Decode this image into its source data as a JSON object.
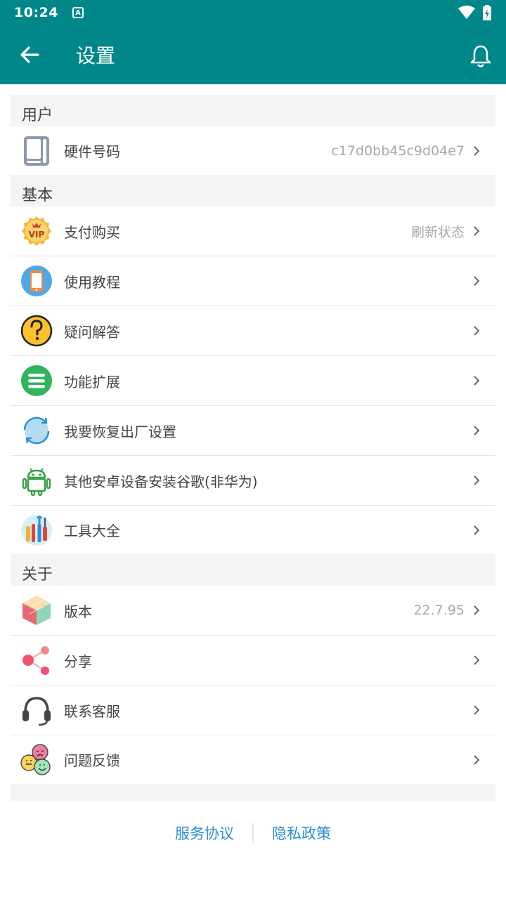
{
  "status": {
    "time": "10:24",
    "a_badge": "A"
  },
  "toolbar": {
    "title": "设置"
  },
  "sections": {
    "user": {
      "header": "用户",
      "hardware": {
        "label": "硬件号码",
        "value": "c17d0bb45c9d04e7"
      }
    },
    "basic": {
      "header": "基本",
      "pay": {
        "label": "支付购买",
        "value": "刷新状态"
      },
      "tutorial": {
        "label": "使用教程"
      },
      "faq": {
        "label": "疑问解答"
      },
      "extend": {
        "label": "功能扩展"
      },
      "reset": {
        "label": "我要恢复出厂设置"
      },
      "android": {
        "label": "其他安卓设备安装谷歌(非华为)"
      },
      "tools": {
        "label": "工具大全"
      }
    },
    "about": {
      "header": "关于",
      "version": {
        "label": "版本",
        "value": "22.7.95"
      },
      "share": {
        "label": "分享"
      },
      "support": {
        "label": "联系客服"
      },
      "feedback": {
        "label": "问题反馈"
      }
    }
  },
  "footer": {
    "service": "服务协议",
    "privacy": "隐私政策"
  },
  "colors": {
    "primary": "#00878a",
    "link": "#2a8fd6"
  }
}
